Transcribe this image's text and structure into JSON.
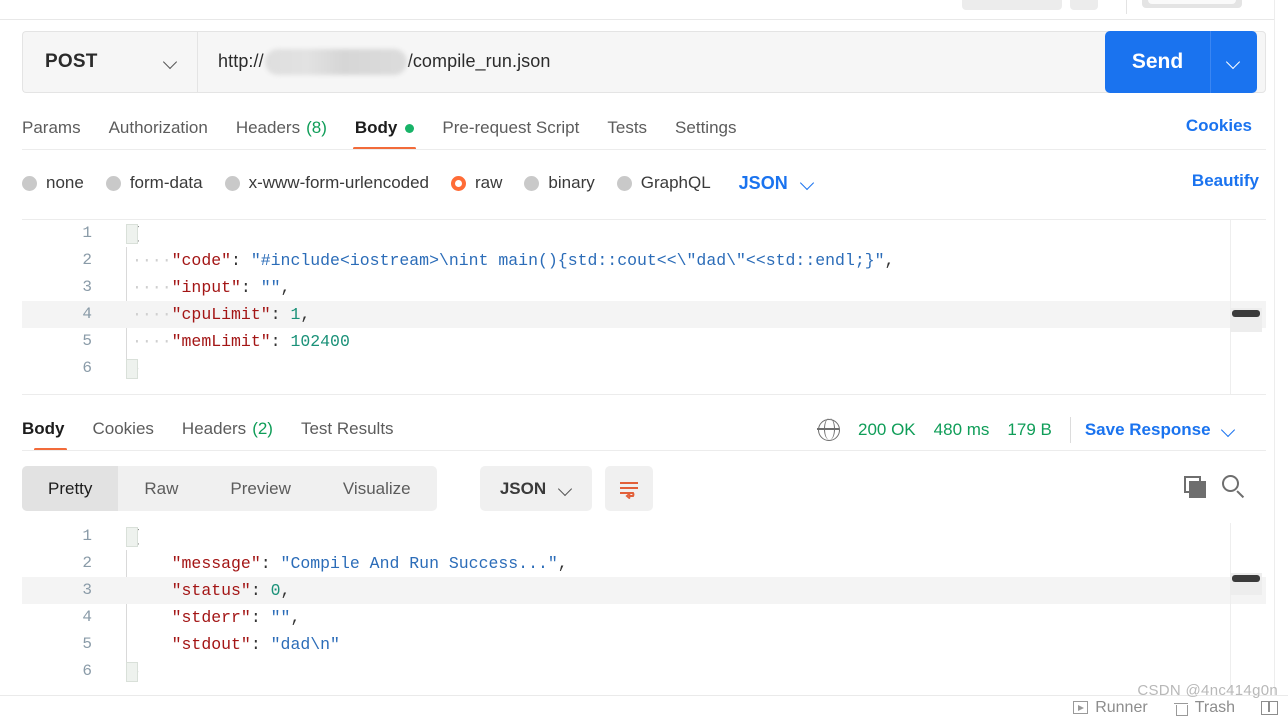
{
  "request": {
    "method": "POST",
    "url_prefix": "http://",
    "url_redacted": "",
    "url_suffix": "/compile_run.json",
    "send_label": "Send",
    "tabs": [
      {
        "label": "Params",
        "count": null,
        "active": false,
        "dot": false
      },
      {
        "label": "Authorization",
        "count": null,
        "active": false,
        "dot": false
      },
      {
        "label": "Headers",
        "count": "(8)",
        "active": false,
        "dot": false
      },
      {
        "label": "Body",
        "count": null,
        "active": true,
        "dot": true
      },
      {
        "label": "Pre-request Script",
        "count": null,
        "active": false,
        "dot": false
      },
      {
        "label": "Tests",
        "count": null,
        "active": false,
        "dot": false
      },
      {
        "label": "Settings",
        "count": null,
        "active": false,
        "dot": false
      }
    ],
    "cookies_link": "Cookies",
    "body_options": [
      {
        "label": "none",
        "selected": false
      },
      {
        "label": "form-data",
        "selected": false
      },
      {
        "label": "x-www-form-urlencoded",
        "selected": false
      },
      {
        "label": "raw",
        "selected": true
      },
      {
        "label": "binary",
        "selected": false
      },
      {
        "label": "GraphQL",
        "selected": false
      }
    ],
    "format_selected": "JSON",
    "beautify_label": "Beautify",
    "body_lines": [
      {
        "num": "1",
        "text": "{",
        "highlight": false
      },
      {
        "num": "2",
        "text": "\"code\": \"#include<iostream>\\nint main(){std::cout<<\\\"dad\\\"<<std::endl;}\",",
        "highlight": false
      },
      {
        "num": "3",
        "text": "\"input\": \"\",",
        "highlight": false
      },
      {
        "num": "4",
        "text": "\"cpuLimit\": 1,",
        "highlight": true
      },
      {
        "num": "5",
        "text": "\"memLimit\": 102400",
        "highlight": false
      },
      {
        "num": "6",
        "text": "}",
        "highlight": false
      }
    ]
  },
  "response": {
    "tabs": [
      {
        "label": "Body",
        "count": null,
        "active": true
      },
      {
        "label": "Cookies",
        "count": null,
        "active": false
      },
      {
        "label": "Headers",
        "count": "(2)",
        "active": false
      },
      {
        "label": "Test Results",
        "count": null,
        "active": false
      }
    ],
    "status": "200 OK",
    "time": "480 ms",
    "size": "179 B",
    "save_response_label": "Save Response",
    "view_modes": [
      {
        "label": "Pretty",
        "active": true
      },
      {
        "label": "Raw",
        "active": false
      },
      {
        "label": "Preview",
        "active": false
      },
      {
        "label": "Visualize",
        "active": false
      }
    ],
    "format_selected": "JSON",
    "body_lines": [
      {
        "num": "1",
        "text": "{",
        "highlight": false
      },
      {
        "num": "2",
        "text": "\"message\": \"Compile And Run Success...\",",
        "highlight": false
      },
      {
        "num": "3",
        "text": "\"status\": 0,",
        "highlight": true
      },
      {
        "num": "4",
        "text": "\"stderr\": \"\",",
        "highlight": false
      },
      {
        "num": "5",
        "text": "\"stdout\": \"dad\\n\"",
        "highlight": false
      },
      {
        "num": "6",
        "text": "}",
        "highlight": false
      }
    ]
  },
  "status_bar": {
    "runner_label": "Runner",
    "trash_label": "Trash"
  },
  "watermark": "CSDN @4nc414g0n",
  "colors": {
    "accent_orange": "#ff6c37",
    "link_blue": "#1a73ef",
    "success_green": "#0f9d58"
  }
}
